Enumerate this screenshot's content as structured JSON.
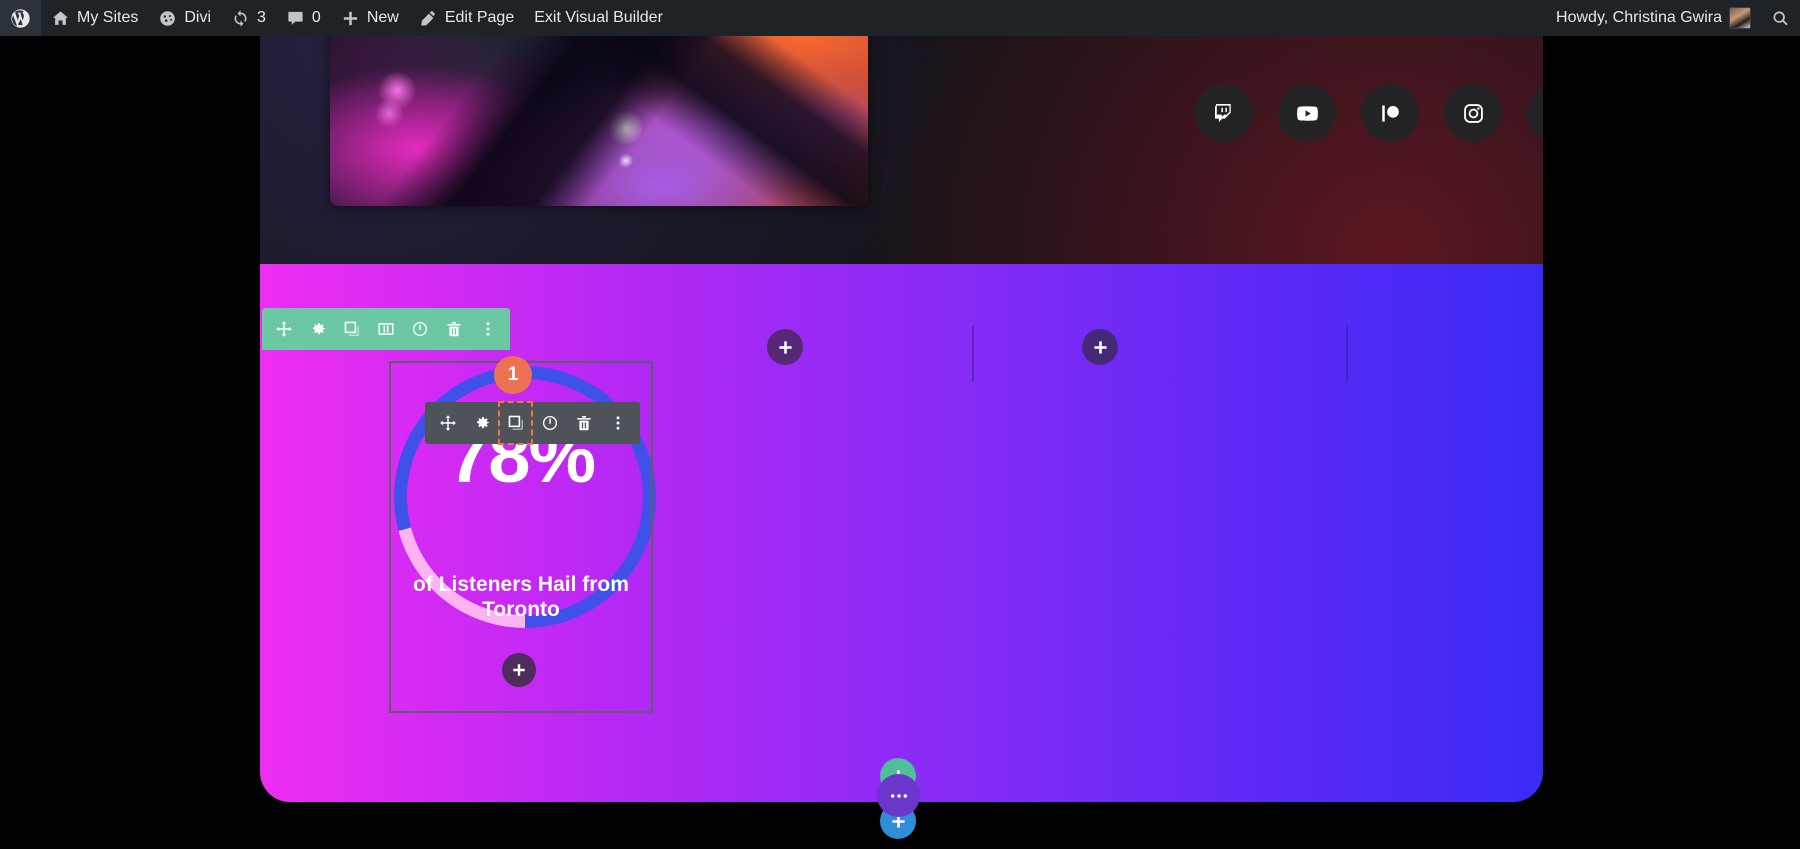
{
  "admin_bar": {
    "items": [
      {
        "icon": "wordpress-logo-icon",
        "label": ""
      },
      {
        "icon": "home-icon",
        "label": "My Sites"
      },
      {
        "icon": "divi-icon",
        "label": "Divi"
      },
      {
        "icon": "updates-icon",
        "label": "3"
      },
      {
        "icon": "comments-icon",
        "label": "0"
      },
      {
        "icon": "plus-icon",
        "label": "New"
      },
      {
        "icon": "pencil-icon",
        "label": "Edit Page"
      },
      {
        "icon": "",
        "label": "Exit Visual Builder"
      }
    ],
    "howdy": "Howdy, Christina Gwira",
    "search_icon": "search-icon"
  },
  "hero": {
    "image_alt": "neon-abstract-photo",
    "cta_label": "",
    "social_icons": [
      {
        "name": "twitch-icon"
      },
      {
        "name": "youtube-icon"
      },
      {
        "name": "patreon-icon"
      },
      {
        "name": "instagram-icon"
      },
      {
        "name": "facebook-icon"
      },
      {
        "name": "twitter-icon"
      }
    ]
  },
  "section": {
    "background_gradient_from": "#ee2df2",
    "background_gradient_to": "#3a2bf5",
    "toolbar": {
      "color": "#6cc8a4",
      "buttons": [
        {
          "name": "move-section-button",
          "icon": "move-icon"
        },
        {
          "name": "section-settings-button",
          "icon": "gear-icon"
        },
        {
          "name": "duplicate-section-button",
          "icon": "duplicate-icon"
        },
        {
          "name": "section-columns-button",
          "icon": "columns-icon"
        },
        {
          "name": "disable-section-button",
          "icon": "power-icon"
        },
        {
          "name": "delete-section-button",
          "icon": "trash-icon"
        },
        {
          "name": "section-more-options-button",
          "icon": "ellipsis-vertical-icon"
        }
      ]
    }
  },
  "module": {
    "badge_number": "1",
    "badge_color": "#ed7254",
    "percent": "78%",
    "title": "of Listeners Hail from Toronto",
    "ring_fill_color": "#3f51e8",
    "ring_track_color": "#ffb3f2",
    "toolbar": {
      "color": "#4d5359",
      "active_index": 2,
      "buttons": [
        {
          "name": "move-module-button",
          "icon": "move-icon"
        },
        {
          "name": "module-settings-button",
          "icon": "gear-icon"
        },
        {
          "name": "duplicate-module-button",
          "icon": "duplicate-icon"
        },
        {
          "name": "disable-module-button",
          "icon": "power-icon"
        },
        {
          "name": "delete-module-button",
          "icon": "trash-icon"
        },
        {
          "name": "module-more-options-button",
          "icon": "ellipsis-vertical-icon"
        }
      ]
    }
  },
  "columns": {
    "add_module_buttons": [
      {
        "name": "add-module-button-column-2",
        "icon": "plus-icon"
      },
      {
        "name": "add-module-button-column-3",
        "icon": "plus-icon"
      }
    ]
  },
  "page_controls": [
    {
      "name": "add-new-section-button",
      "icon": "plus-icon",
      "color": "#4fbf9b"
    },
    {
      "name": "page-settings-button",
      "icon": "ellipsis-horizontal-icon",
      "color": "#6a36cc"
    },
    {
      "name": "add-new-row-button",
      "icon": "plus-icon",
      "color": "#2e8fd8"
    }
  ]
}
